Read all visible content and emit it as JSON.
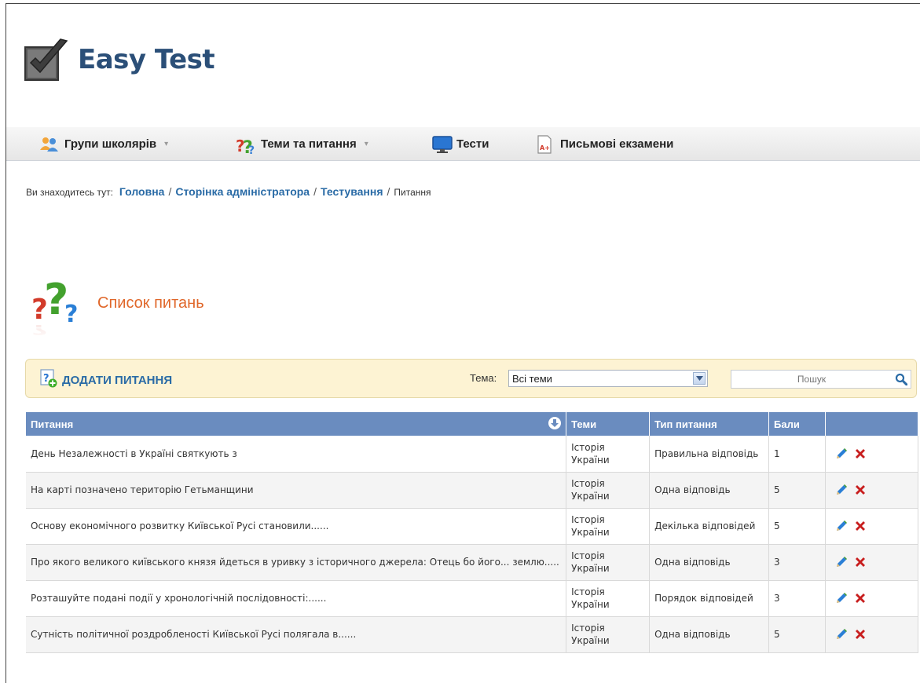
{
  "app": {
    "name": "Easy Test"
  },
  "nav": [
    {
      "label": "Групи школярів",
      "icon": "users-icon",
      "has_dropdown": true
    },
    {
      "label": "Теми та питання",
      "icon": "question-icon",
      "has_dropdown": true
    },
    {
      "label": "Тести",
      "icon": "monitor-icon",
      "has_dropdown": false
    },
    {
      "label": "Письмові екзамени",
      "icon": "exam-document-icon",
      "has_dropdown": false
    }
  ],
  "nav_caret": "▾",
  "breadcrumb": {
    "prefix": "Ви знаходитесь тут:",
    "links": [
      "Головна",
      "Сторінка адміністратора",
      "Тестування"
    ],
    "current": "Питання",
    "separator": "/"
  },
  "section": {
    "title": "Список питань",
    "icon": "questions-icon"
  },
  "toolbar": {
    "add_label": "ДОДАТИ ПИТАННЯ",
    "theme_label": "Тема:",
    "theme_value": "Всі теми",
    "search_placeholder": "Пошук"
  },
  "table": {
    "headers": {
      "question": "Питання",
      "topics": "Теми",
      "type": "Тип питання",
      "score": "Бали"
    },
    "rows": [
      {
        "question": "День Незалежності в Україні святкують з",
        "topic": "Історія України",
        "type": "Правильна відповідь",
        "score": "1"
      },
      {
        "question": "На карті позначено територію Гетьманщини",
        "topic": "Історія України",
        "type": "Одна відповідь",
        "score": "5"
      },
      {
        "question": "Основу економічного розвитку Київської Русі становили......",
        "topic": "Історія України",
        "type": "Декілька відповідей",
        "score": "5"
      },
      {
        "question": "Про якого великого київського князя йдеться в уривку з історичного джерела: Отець бо його... землю.....",
        "topic": "Історія України",
        "type": "Одна відповідь",
        "score": "3"
      },
      {
        "question": "Розташуйте подані події у хронологічній послідовності:......",
        "topic": "Історія України",
        "type": "Порядок відповідей",
        "score": "3"
      },
      {
        "question": "Сутність політичної роздробленості Київської Русі полягала в......",
        "topic": "Історія України",
        "type": "Одна відповідь",
        "score": "5"
      }
    ]
  },
  "colors": {
    "brand": "#2b4f78",
    "link": "#2a6ba6",
    "header_bg": "#6a8cbf",
    "toolbar_bg": "#fdf3d3",
    "title": "#e0672a",
    "delete": "#c81e1e"
  }
}
